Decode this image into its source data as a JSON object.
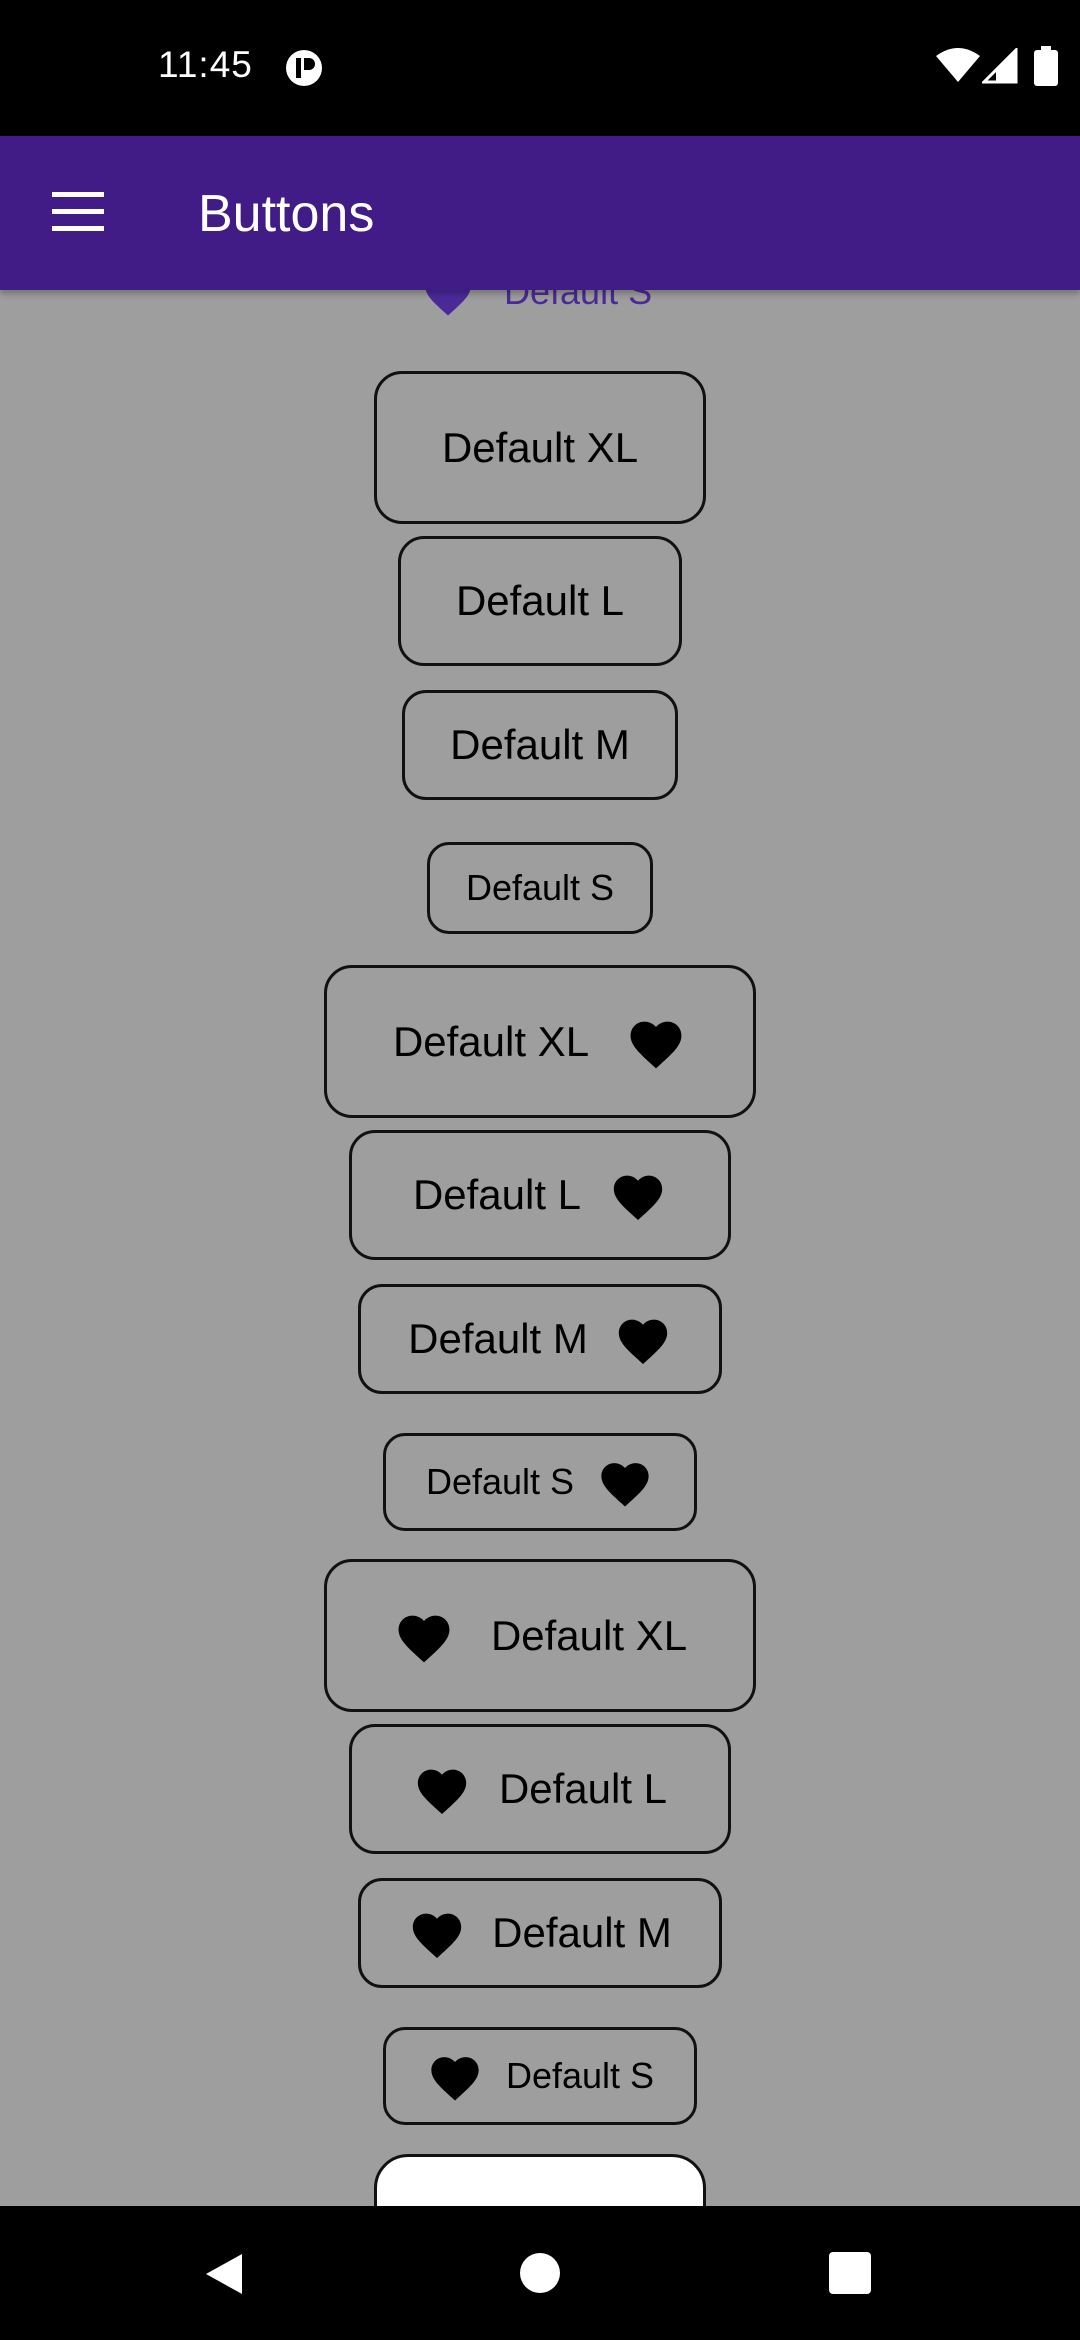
{
  "status_bar": {
    "time": "11:45"
  },
  "app_bar": {
    "title": "Buttons"
  },
  "peek_button": {
    "label": "Default S"
  },
  "buttons": [
    {
      "label": "Default XL"
    },
    {
      "label": "Default L"
    },
    {
      "label": "Default M"
    },
    {
      "label": "Default S"
    },
    {
      "label": "Default XL",
      "icon": "heart-icon",
      "icon_position": "trailing"
    },
    {
      "label": "Default L",
      "icon": "heart-icon",
      "icon_position": "trailing"
    },
    {
      "label": "Default M",
      "icon": "heart-icon",
      "icon_position": "trailing"
    },
    {
      "label": "Default S",
      "icon": "heart-icon",
      "icon_position": "trailing"
    },
    {
      "label": "Default XL",
      "icon": "heart-icon",
      "icon_position": "leading"
    },
    {
      "label": "Default L",
      "icon": "heart-icon",
      "icon_position": "leading"
    },
    {
      "label": "Default M",
      "icon": "heart-icon",
      "icon_position": "leading"
    },
    {
      "label": "Default S",
      "icon": "heart-icon",
      "icon_position": "leading"
    }
  ],
  "colors": {
    "app_bar": "#421c86",
    "background": "#9e9e9e",
    "accent_text": "#4a2a99"
  }
}
